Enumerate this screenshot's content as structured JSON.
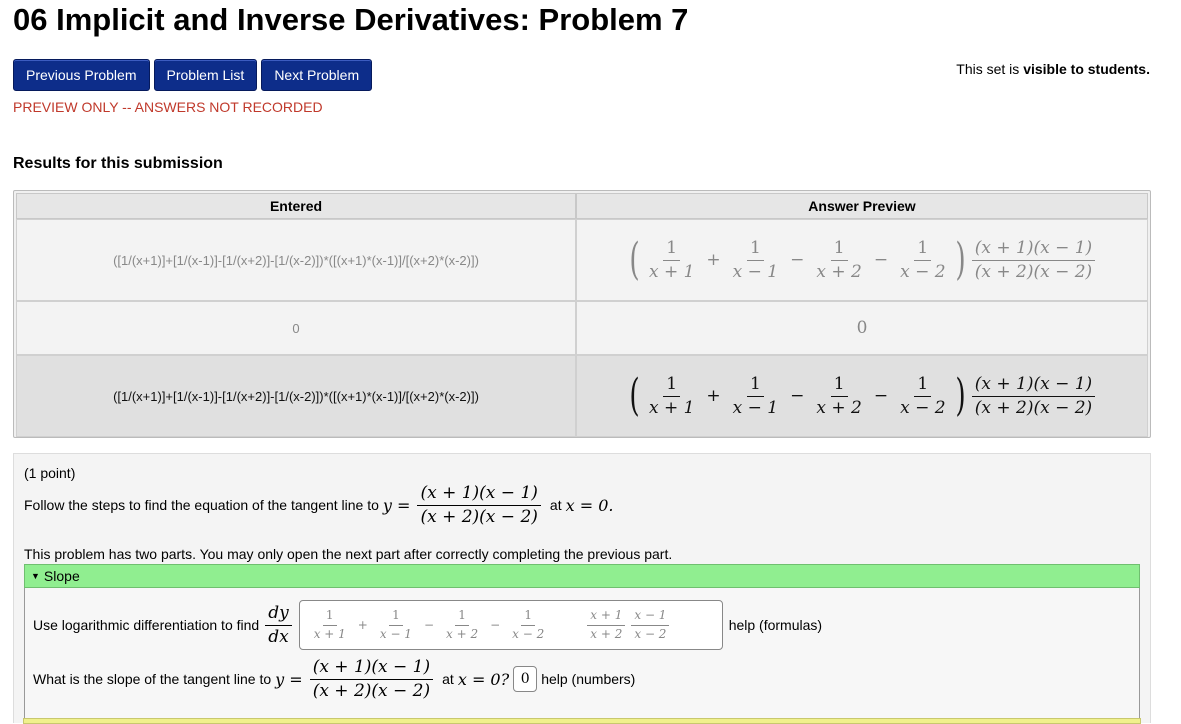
{
  "title": "06 Implicit and Inverse Derivatives: Problem 7",
  "nav": {
    "prev": "Previous Problem",
    "list": "Problem List",
    "next": "Next Problem"
  },
  "set_info": {
    "prefix": "This set is ",
    "status": "visible to students."
  },
  "preview_notice": "PREVIEW ONLY -- ANSWERS NOT RECORDED",
  "results": {
    "heading": "Results for this submission",
    "col_entered": "Entered",
    "col_preview": "Answer Preview",
    "rows": [
      {
        "entered": "([1/(x+1)]+[1/(x-1)]-[1/(x+2)]-[1/(x-2)])*([(x+1)*(x-1)]/[(x+2)*(x-2)])",
        "preview_kind": "expr"
      },
      {
        "entered": "0",
        "preview_text": "0"
      },
      {
        "entered": "([1/(x+1)]+[1/(x-1)]-[1/(x+2)]-[1/(x-2)])*([(x+1)*(x-1)]/[(x+2)*(x-2)])",
        "preview_kind": "expr"
      }
    ]
  },
  "math": {
    "one": "1",
    "x_plus_1": "x + 1",
    "x_minus_1": "x − 1",
    "x_plus_2": "x + 2",
    "x_minus_2": "x − 2",
    "num_prod": "(x + 1)(x − 1)",
    "den_prod": "(x + 2)(x − 2)",
    "plus": "+",
    "minus": "−",
    "lparen": "(",
    "rparen": ")"
  },
  "problem": {
    "points": "(1 point)",
    "follow_prefix": "Follow the steps to find the equation of the tangent line to ",
    "y_eq": "y =",
    "at_text": "at ",
    "x_eq_0": "x = 0.",
    "parts_note": "This problem has two parts. You may only open the next part after correctly completing the previous part.",
    "slope_label": "Slope",
    "q1_prefix": "Use logarithmic differentiation to find",
    "dy": "dy",
    "dx": "dx",
    "help_formulas": "help (formulas)",
    "q2_prefix": "What is the slope of the tangent line to ",
    "q2_at": "at ",
    "q2_x": "x = 0?",
    "q2_answer": "0",
    "help_numbers": "help (numbers)"
  }
}
